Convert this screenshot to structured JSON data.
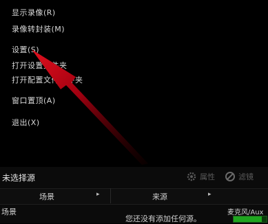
{
  "menu": {
    "items": [
      {
        "label": "显示录像(R)"
      },
      {
        "label": "录像转封装(M)"
      },
      {
        "label": "设置(S)"
      },
      {
        "label": "打开设置文件夹"
      },
      {
        "label": "打开配置文件文件夹"
      },
      {
        "label": "窗口置顶(A)"
      },
      {
        "label": "退出(X)"
      }
    ]
  },
  "source_panel": {
    "selection": "未选择源",
    "properties_button": "属性",
    "filters_button": "滤镜"
  },
  "columns": {
    "scenes": "场景",
    "sources": "来源"
  },
  "scenes_list": {
    "first_item": "场景"
  },
  "sources_hint": "您还没有添加任何源。",
  "audio_mixer": {
    "label": "麦克风/Aux",
    "level": 0.85
  },
  "colors": {
    "arrow": "#c00010",
    "meter": "#1fa51f"
  }
}
